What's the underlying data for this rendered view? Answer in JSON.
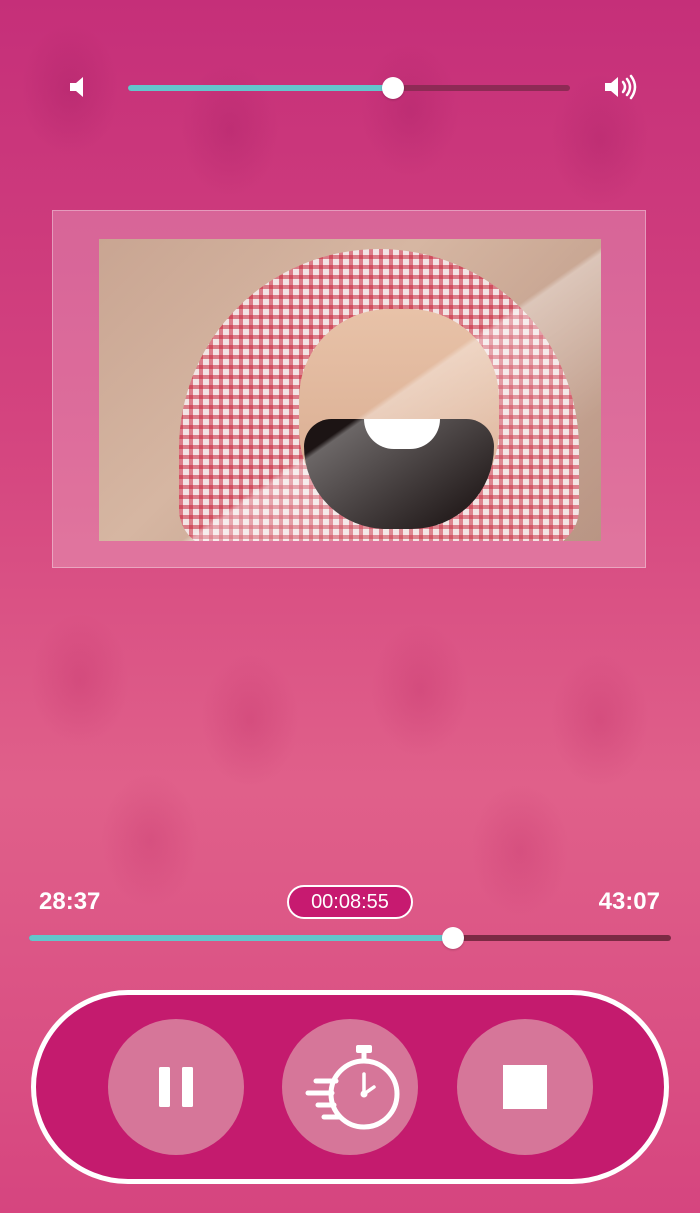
{
  "volume": {
    "low_icon": "volume-low-icon",
    "high_icon": "volume-high-icon",
    "level": 0.6
  },
  "player": {
    "elapsed": "28:37",
    "remaining": "00:08:55",
    "total": "43:07",
    "progress": 0.66
  },
  "controls": {
    "pause_icon": "pause-icon",
    "timer_icon": "sleep-timer-icon",
    "stop_icon": "stop-icon"
  },
  "colors": {
    "accent": "#63c6cc",
    "panel": "#c41b6e",
    "button": "#d67699"
  }
}
